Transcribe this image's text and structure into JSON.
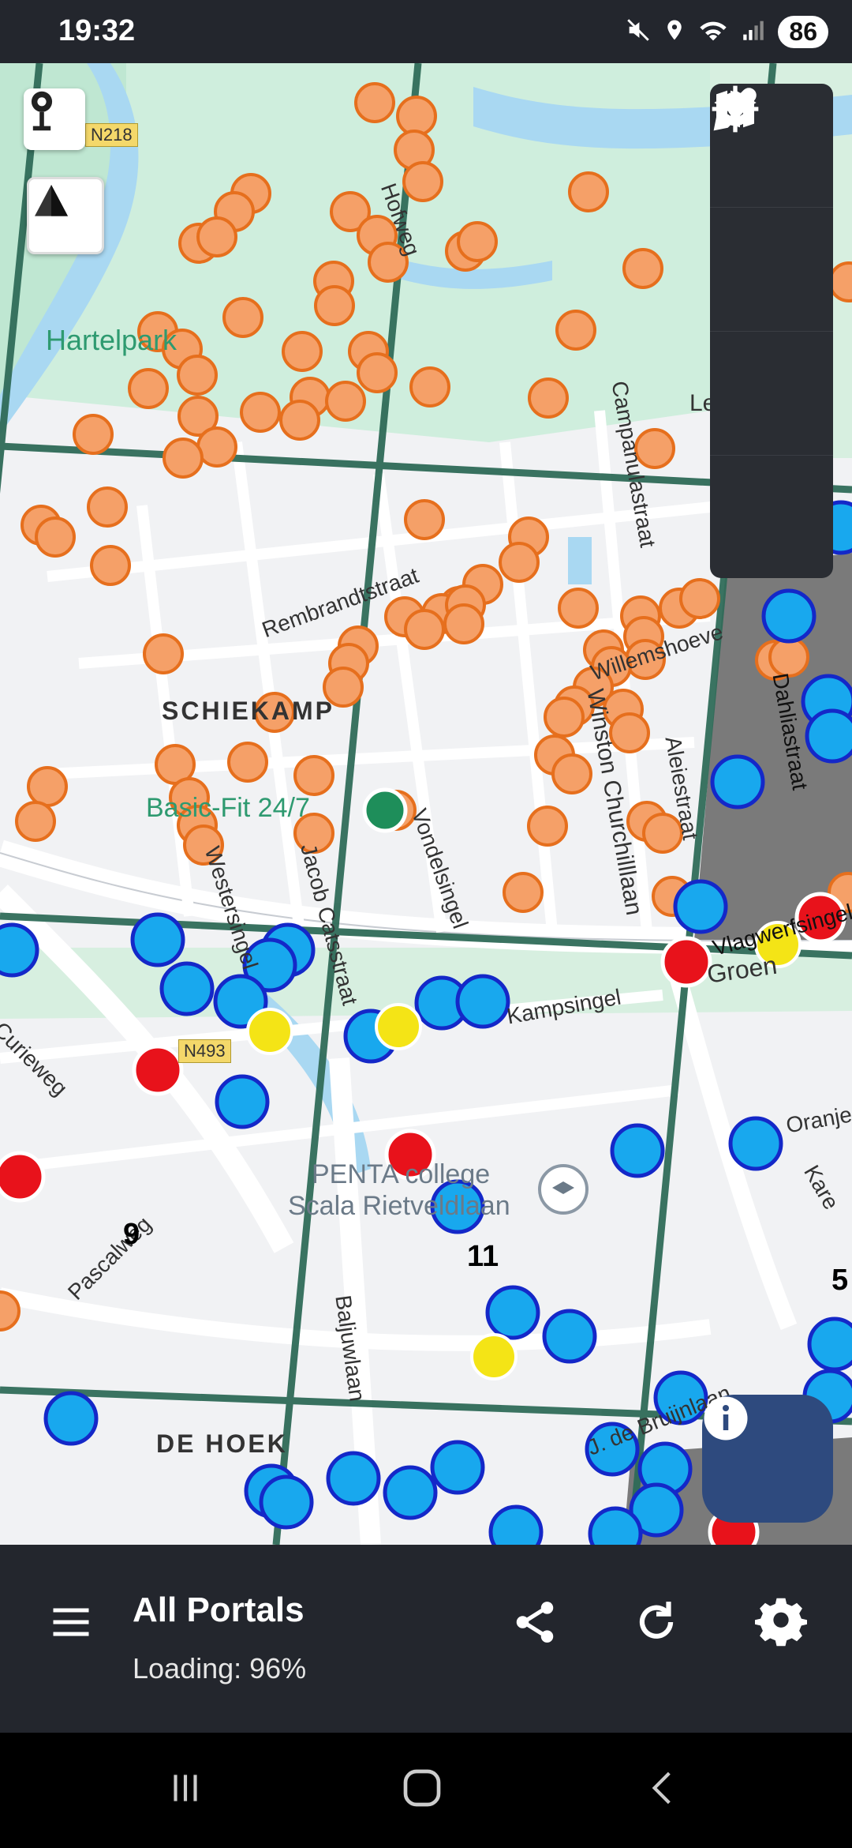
{
  "status_bar": {
    "time": "19:32",
    "battery": "86",
    "icons": [
      "mute-icon",
      "location-icon",
      "wifi-icon",
      "signal-icon"
    ]
  },
  "map": {
    "labels": {
      "road_n218": "N218",
      "road_n493": "N493",
      "park": "Hartelpark",
      "district_schiekamp": "SCHIEKAMP",
      "district_dehoek": "DE HOEK",
      "poi_basicfit": "Basic-Fit 24/7",
      "poi_penta": "PENTA college",
      "poi_penta2": "Scala Rietveldlaan",
      "street_rembrandt": "Rembrandtstraat",
      "street_vondel": "Vondelsingel",
      "street_jacobcats": "Jacob Catsstraat",
      "street_westersingel": "Westersingel",
      "street_campanula": "Campanulastraat",
      "street_willemshoeve": "Willemshoeve",
      "street_churchill": "Winston Churchilllaan",
      "street_aleiestraat": "Aleiestraat",
      "street_dahlia": "Dahliastraat",
      "street_groen": "Groen",
      "street_kampsingel": "Kampsingel",
      "street_curieweg": "Curieweg",
      "street_pascalweg": "Pascalweg",
      "street_baljuwlaan": "Baljuwlaan",
      "street_jdeb": "J. de Bruijnlaan",
      "street_oranje": "Oranje",
      "street_kare": "Kare",
      "street_hofweg": "Hofweg",
      "street_vlagwerf": "Vlagwerfsingel",
      "street_le": "Le",
      "cell_9": "9",
      "cell_11": "11",
      "cell_5": "5"
    },
    "portal_colors": {
      "orange": "#f08b3c",
      "blue": "#1aa3ee",
      "red": "#e8121b",
      "yellow": "#f4e416"
    }
  },
  "right_panel": {
    "buttons": [
      "map-icon",
      "layers-icon",
      "eyedropper-icon",
      "locate-icon"
    ]
  },
  "bottom_bar": {
    "title": "All Portals",
    "subtitle": "Loading: 96%"
  }
}
